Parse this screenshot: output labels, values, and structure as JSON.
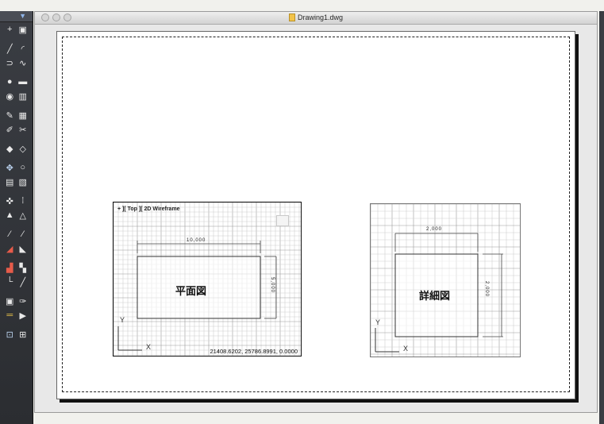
{
  "window": {
    "title": "Drawing1.dwg"
  },
  "palette": {
    "header_arrow": "▼"
  },
  "tools": [
    [
      "crosshair-icon",
      "paint-icon"
    ],
    [
      "line-icon",
      "arc-icon"
    ],
    [
      "polyline-icon",
      "spline-icon"
    ],
    [
      "circle-icon",
      "rectangle-icon"
    ],
    [
      "ellipse-icon",
      "hatch-icon"
    ],
    [
      "text-icon",
      "table-icon"
    ],
    [
      "pencil-icon",
      "hatch-edit-icon"
    ],
    [
      "layer-icon",
      "eraser-icon"
    ],
    [
      "move-icon",
      "rotate-icon"
    ],
    [
      "copy-icon",
      "block-icon"
    ],
    [
      "snap-icon",
      "grid-icon"
    ],
    [
      "mirror-icon",
      "offset-icon"
    ],
    [
      "trim-icon",
      "extend-icon"
    ],
    [
      "fillet-icon",
      "chamfer-icon"
    ],
    [
      "layer-color-icon",
      "properties-icon"
    ],
    [
      "dimension-icon",
      "leader-icon"
    ],
    [
      "array-icon",
      "match-icon"
    ],
    [
      "layout-icon",
      "measure-icon"
    ],
    [
      "zoom-icon",
      "pan-icon"
    ]
  ],
  "viewport1": {
    "controls": "+ ][ Top ][ 2D Wireframe",
    "label": "平面図",
    "dim_h": "10,000",
    "dim_v": "5,000",
    "coords": "21408.6202, 25786.8991, 0.0000",
    "axis_y": "Y",
    "axis_x": "X"
  },
  "viewport2": {
    "label": "詳細図",
    "dim_h": "2,000",
    "dim_v": "2,000",
    "axis_y": "Y",
    "axis_x": "X"
  }
}
